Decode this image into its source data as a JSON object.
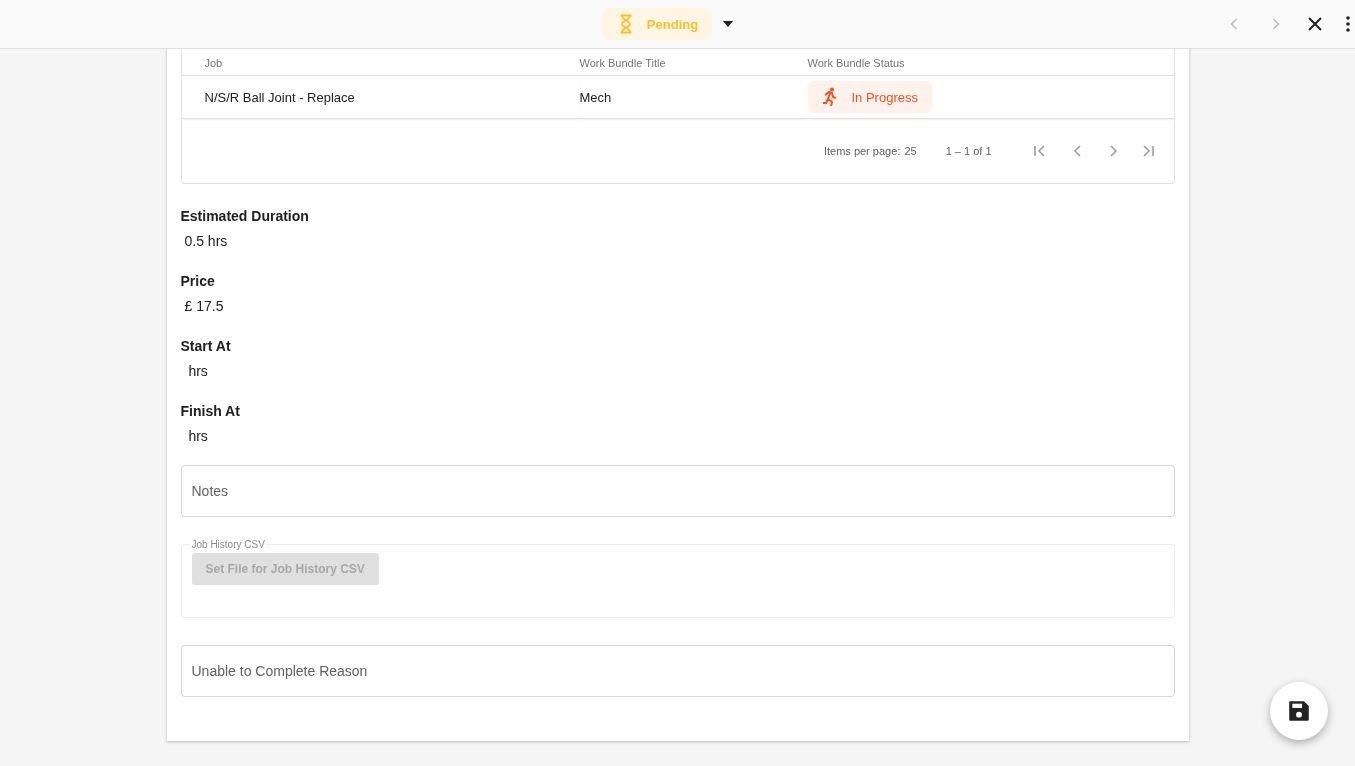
{
  "top_bar": {
    "status": {
      "label": "Pending"
    },
    "nav": [
      {
        "kind": "prev",
        "disabled": true
      },
      {
        "kind": "next",
        "disabled": true
      }
    ]
  },
  "table": {
    "columns": [
      "Job",
      "Work Bundle Title",
      "Work Bundle Status"
    ],
    "rows": [
      {
        "job": "N/S/R Ball Joint - Replace",
        "work_bundle_title": "Mech",
        "status": {
          "label": "In Progress"
        }
      }
    ],
    "paginator": {
      "items_per_page_label": "Items per page:",
      "page_size": "25",
      "range": "1 – 1 of 1"
    }
  },
  "fields": [
    {
      "label": "Estimated Duration",
      "value": "0.5 hrs"
    },
    {
      "label": "Price",
      "value": "£ 17.5"
    },
    {
      "label": "Start At",
      "value": " hrs"
    },
    {
      "label": "Finish At",
      "value": " hrs"
    }
  ],
  "notes": {
    "placeholder": "Notes"
  },
  "file_upload": {
    "legend": "Job History CSV",
    "button": {
      "label": "Set File for Job History CSV",
      "disabled": true
    }
  },
  "reason": {
    "placeholder": "Unable to Complete Reason"
  }
}
